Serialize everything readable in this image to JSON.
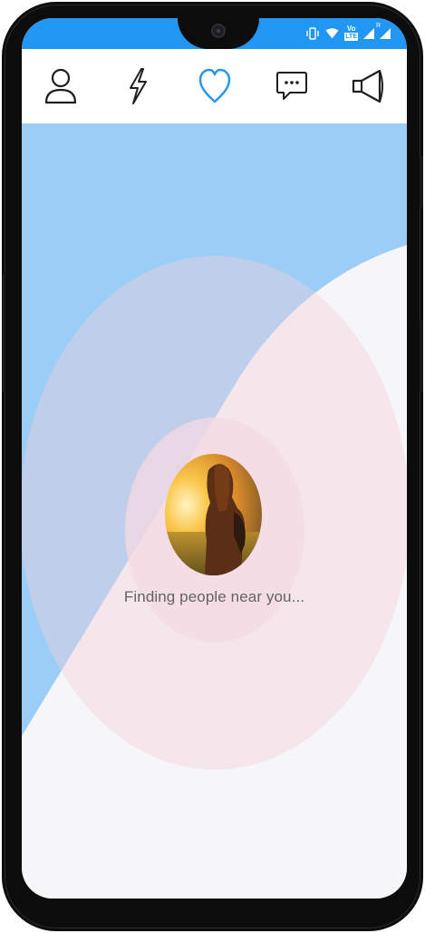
{
  "colors": {
    "accent": "#2196f3",
    "active_icon": "#2196f3",
    "inactive_icon": "#1e1e1e",
    "background_blue": "#9ccdf6",
    "background_pink": "#f6e7ee",
    "text_gray": "#636363"
  },
  "status_bar": {
    "icons": [
      "vibrate-icon",
      "wifi-icon",
      "volte-lte-icon",
      "signal-icon",
      "signal-roaming-icon"
    ],
    "volte_label": "Vo",
    "lte_label": "LTE",
    "roaming_label": "R"
  },
  "nav": {
    "items": [
      {
        "icon": "profile-icon",
        "active": false
      },
      {
        "icon": "lightning-icon",
        "active": false
      },
      {
        "icon": "heart-icon",
        "active": true
      },
      {
        "icon": "chat-icon",
        "active": false
      },
      {
        "icon": "megaphone-icon",
        "active": false
      }
    ]
  },
  "main": {
    "status_text": "Finding people near you...",
    "avatar_description": "profile photo"
  }
}
